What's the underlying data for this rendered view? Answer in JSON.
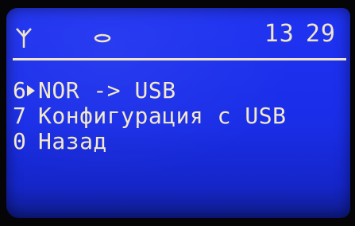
{
  "status": {
    "hours": "13",
    "minutes": "29",
    "icons": [
      "antenna-icon",
      "link-icon"
    ]
  },
  "menu": {
    "items": [
      {
        "number": "6",
        "label": "NOR -> USB",
        "selected": true
      },
      {
        "number": "7",
        "label": "Конфигурация с USB",
        "selected": false
      },
      {
        "number": "0",
        "label": "Назад",
        "selected": false
      }
    ]
  },
  "colors": {
    "background": "#1f33f2",
    "text": "#f3e9cc"
  }
}
